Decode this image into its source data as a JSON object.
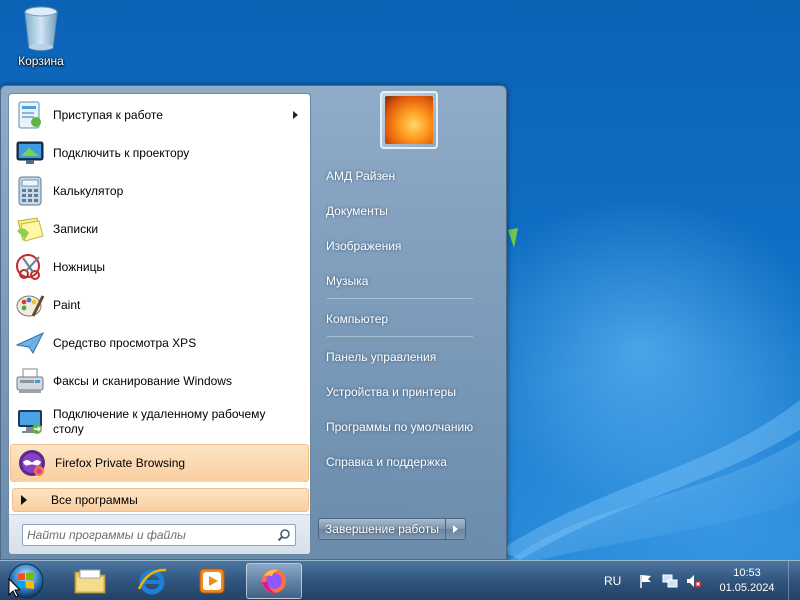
{
  "desktop": {
    "recycle_bin_label": "Корзина"
  },
  "start_menu": {
    "programs": [
      {
        "label": "Приступая к работе",
        "icon": "getting-started-icon",
        "has_submenu": true
      },
      {
        "label": "Подключить к проектору",
        "icon": "projector-icon"
      },
      {
        "label": "Калькулятор",
        "icon": "calculator-icon"
      },
      {
        "label": "Записки",
        "icon": "sticky-notes-icon"
      },
      {
        "label": "Ножницы",
        "icon": "scissors-icon"
      },
      {
        "label": "Paint",
        "icon": "paint-icon"
      },
      {
        "label": "Средство просмотра XPS",
        "icon": "xps-viewer-icon"
      },
      {
        "label": "Факсы и сканирование Windows",
        "icon": "fax-scan-icon"
      },
      {
        "label": "Подключение к удаленному рабочему столу",
        "icon": "remote-desktop-icon"
      },
      {
        "label": "Firefox Private Browsing",
        "icon": "firefox-private-icon",
        "highlighted": true
      }
    ],
    "all_programs_label": "Все программы",
    "search_placeholder": "Найти программы и файлы",
    "right_links": [
      "АМД Райзен",
      "Документы",
      "Изображения",
      "Музыка",
      "Компьютер",
      "Панель управления",
      "Устройства и принтеры",
      "Программы по умолчанию",
      "Справка и поддержка"
    ],
    "shutdown_label": "Завершение работы"
  },
  "taskbar": {
    "pinned": [
      "explorer-icon",
      "internet-explorer-icon",
      "media-player-icon",
      "firefox-icon"
    ],
    "language": "RU",
    "time": "10:53",
    "date": "01.05.2024"
  },
  "colors": {
    "highlight": "#f9cfa0",
    "desktop_blue": "#0f6fc4",
    "taskbar": "#32557d"
  }
}
